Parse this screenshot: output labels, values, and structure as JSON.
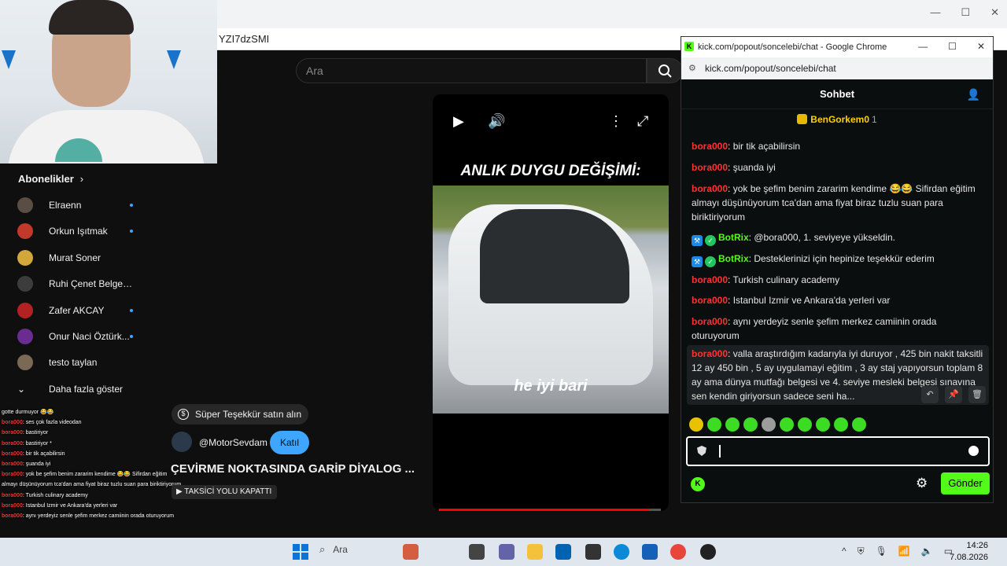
{
  "browser": {
    "url_fragment": "YZI7dzSMI",
    "search_placeholder": "Ara"
  },
  "sidebar": {
    "section_title": "Abonelikler",
    "chevron": "›",
    "items": [
      {
        "label": "Elraenn",
        "dot": true,
        "color": "#5a4d44"
      },
      {
        "label": "Orkun Işıtmak",
        "dot": true,
        "color": "#c0392b"
      },
      {
        "label": "Murat Soner",
        "dot": false,
        "color": "#d4a73a"
      },
      {
        "label": "Ruhi Çenet Belgese...",
        "dot": false,
        "color": "#3c3c3c"
      },
      {
        "label": "Zafer AKCAY",
        "dot": true,
        "color": "#b22222"
      },
      {
        "label": "Onur Naci Öztürk...",
        "dot": true,
        "color": "#6a2c91"
      },
      {
        "label": "testo taylan",
        "dot": false,
        "color": "#7a6a55"
      }
    ],
    "more_label": "Daha fazla göster"
  },
  "overlay_log": [
    {
      "u": "",
      "t": "gotte durmuyor 😂😂"
    },
    {
      "u": "bora000",
      "t": ": ses çok fazla videodan"
    },
    {
      "u": "bora000",
      "t": ": bastiriyor"
    },
    {
      "u": "bora000",
      "t": ": bastiriyor *"
    },
    {
      "u": "bora000",
      "t": ": bir tik açabilirsin"
    },
    {
      "u": "bora000",
      "t": ": şuanda iyi"
    },
    {
      "u": "bora000",
      "t": ": yok be şefim benim zararim kendime 😂😂 Sifirdan eğitim"
    },
    {
      "u": "",
      "t": "almayı düşünüyorum tca'dan ama fiyat biraz tuzlu suan para biriktiriyorum"
    },
    {
      "u": "bora000",
      "t": ": Turkish culinary academy"
    },
    {
      "u": "bora000",
      "t": ": Istanbul Izmir ve Ankara'da yerleri var"
    },
    {
      "u": "bora000",
      "t": ": aynı yerdeyiz senle şefim merkez camiinin orada oturuyorum"
    }
  ],
  "player": {
    "title_text": "ANLIK DUYGU DEĞİŞİMİ:",
    "caption": "he iyi bari",
    "progress": 0.95
  },
  "below_player": {
    "super_thanks_label": "Süper Teşekkür satın alın",
    "channel": "@MotorSevdam",
    "join_label": "Katıl",
    "video_title": "ÇEVİRME NOKTASINDA GARİP DİYALOG ...",
    "tag_label": "TAKSİCİ YOLU KAPATTI"
  },
  "chat_window": {
    "window_title": "kick.com/popout/soncelebi/chat - Google Chrome",
    "url": "kick.com/popout/soncelebi/chat",
    "header": "Sohbet",
    "pinned": {
      "name": "BenGorkem0",
      "count": "1"
    },
    "messages": [
      {
        "user": "bora000",
        "text": ": bir tik açabilirsin",
        "bot": false
      },
      {
        "user": "bora000",
        "text": ": şuanda iyi",
        "bot": false
      },
      {
        "user": "bora000",
        "text": ": yok be şefim benim zararim kendime 😂😂 Sifirdan eğitim almayı düşünüyorum tca'dan ama fiyat biraz tuzlu suan para biriktiriyorum",
        "bot": false
      },
      {
        "user": "BotRix",
        "text": ": @bora000, 1. seviyeye yükseldin.",
        "bot": true
      },
      {
        "user": "BotRix",
        "text": ": Desteklerinizi için hepinize teşekkür ederim",
        "bot": true
      },
      {
        "user": "bora000",
        "text": ": Turkish culinary academy",
        "bot": false
      },
      {
        "user": "bora000",
        "text": ": Istanbul Izmir ve Ankara'da yerleri var",
        "bot": false
      },
      {
        "user": "bora000",
        "text": ": aynı yerdeyiz senle şefim merkez camiinin orada oturuyorum",
        "bot": false
      },
      {
        "user": "bora000",
        "text": ": valla araştırdığım kadarıyla iyi duruyor , 425 bin nakit taksitli 12 ay 450 bin , 5 ay uygulamayi eğitim , 3 ay staj yapıyorsun toplam 8 ay ama dünya mutfağı belgesi ve 4. seviye mesleki belgesi sınavına sen kendin giriyorsun sadece seni ha...",
        "bot": false
      }
    ],
    "send_label": "Gönder"
  },
  "taskbar": {
    "search_label": "Ara",
    "time": "14:26",
    "date": "7.08.2026"
  }
}
